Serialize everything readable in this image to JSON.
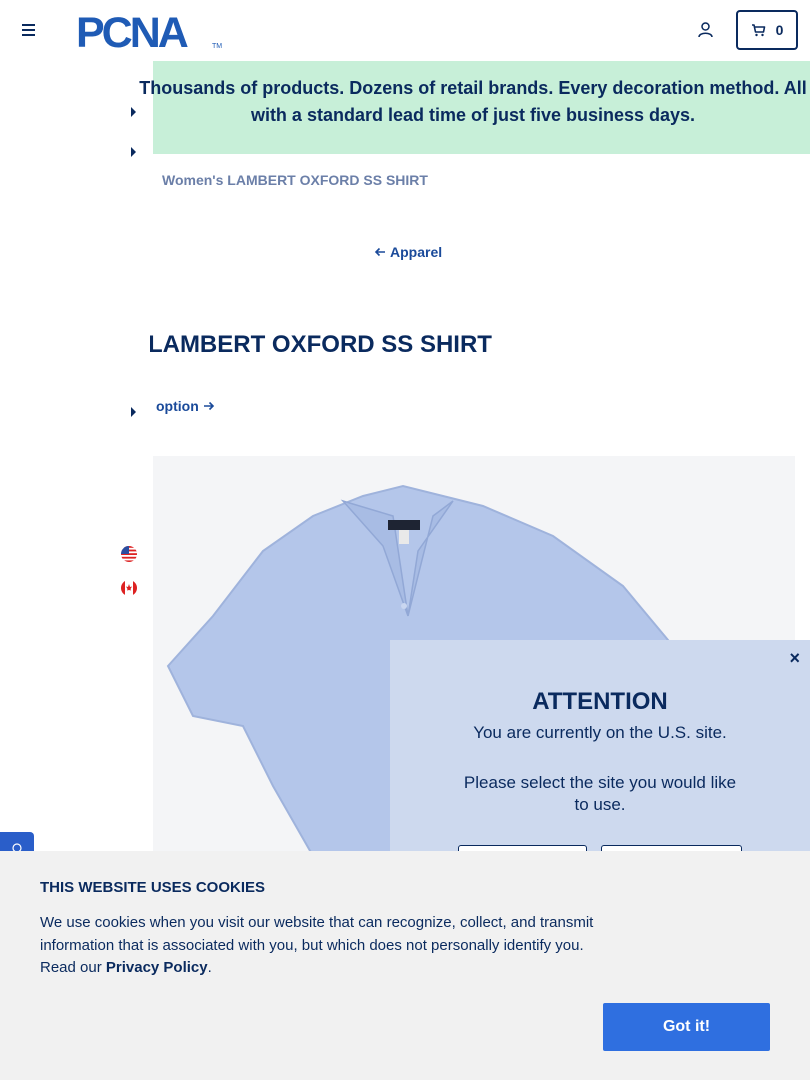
{
  "header": {
    "logo_text": "PCNA",
    "logo_tm": "TM",
    "cart_count": "0"
  },
  "banner": {
    "text": "Thousands of products. Dozens of retail brands. Every decoration method. All with a standard lead time of just five business days."
  },
  "breadcrumb": "Women's LAMBERT OXFORD SS SHIRT",
  "back_link": "Apparel",
  "product": {
    "title": "Women's LAMBERT OXFORD SS SHIRT",
    "option_link": "option",
    "shirt_color": "#b4c6ea"
  },
  "modal": {
    "close": "×",
    "title": "ATTENTION",
    "line1": "You are currently on the U.S. site.",
    "line2": "Please select the site you would like to use."
  },
  "cookie": {
    "title": "THIS WEBSITE USES COOKIES",
    "text": "We use cookies when you visit our website that can recognize, collect, and transmit information that is associated with you, but which does not personally identify you. Read our ",
    "privacy_link": "Privacy Policy",
    "text_end": ".",
    "button": "Got it!"
  },
  "colors": {
    "navy": "#0a2a5e",
    "banner_green": "#c7efd8",
    "modal_bg": "#cdd9ee",
    "button_blue": "#2f6fe0"
  }
}
